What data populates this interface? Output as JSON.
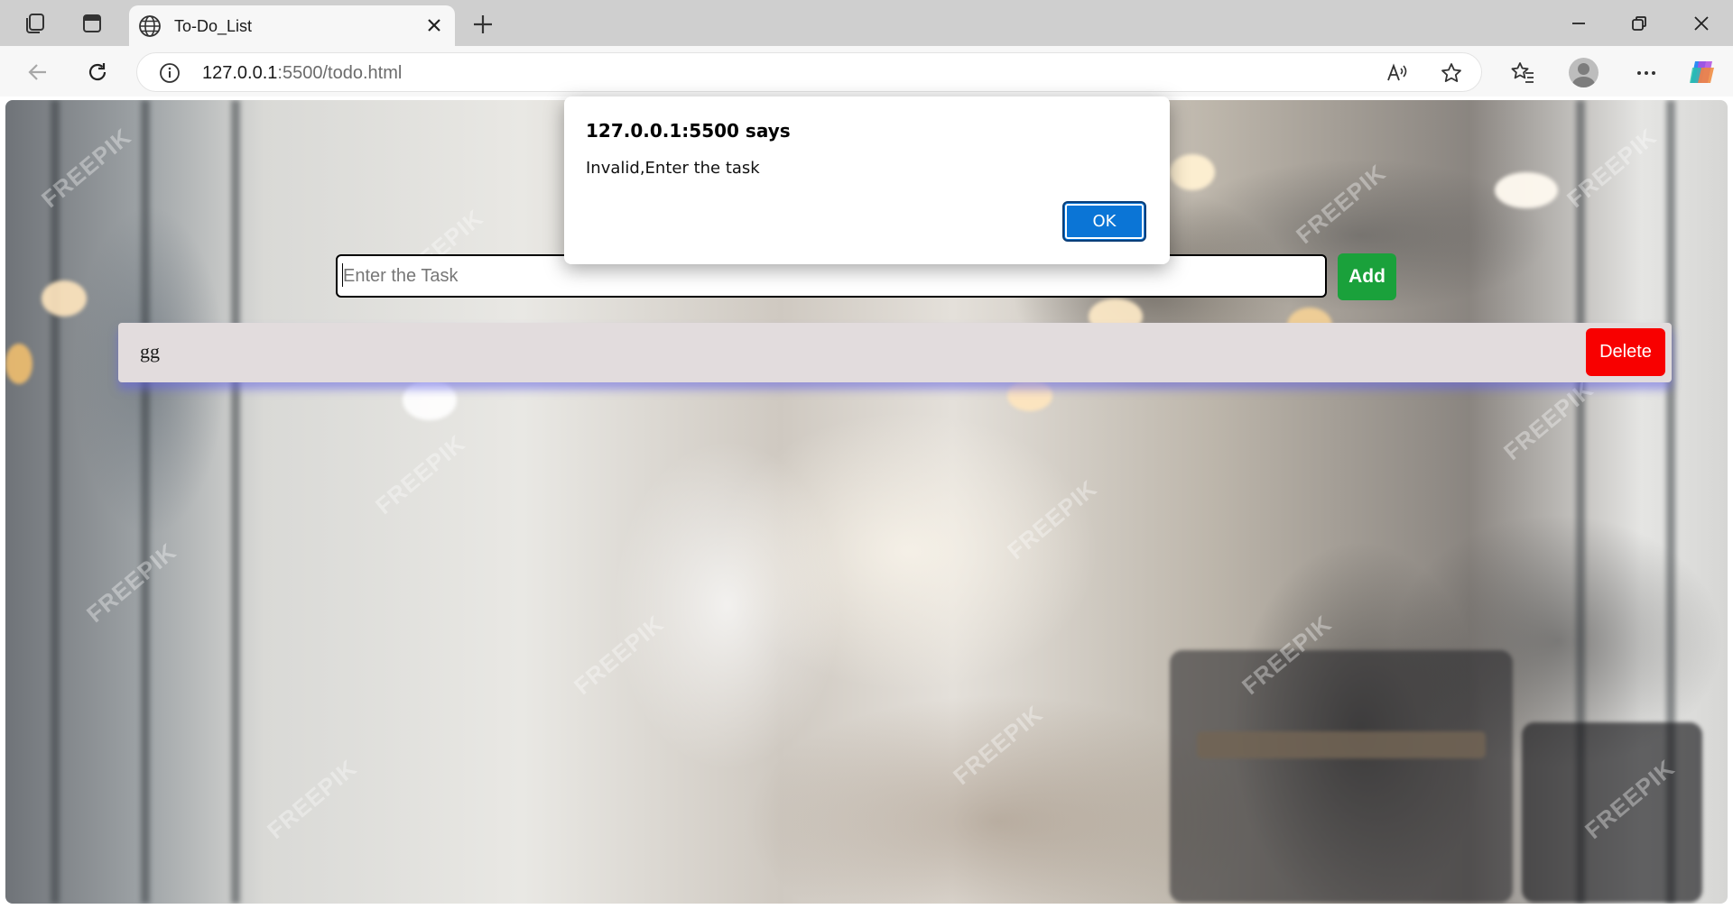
{
  "browser": {
    "tab_title": "To-Do_List",
    "url_host": "127.0.0.1",
    "url_rest": ":5500/todo.html"
  },
  "icons": {
    "workspaces": "workspaces-icon",
    "tab_actions": "tab-actions-icon",
    "site": "globe-icon",
    "tab_close": "close-icon",
    "new_tab": "plus-icon",
    "minimize": "minimize-icon",
    "restore": "restore-icon",
    "window_close": "close-icon",
    "back": "back-arrow-icon",
    "refresh": "refresh-icon",
    "info": "info-icon",
    "read_aloud": "read-aloud-icon",
    "favorite": "star-icon",
    "favorites": "favorites-icon",
    "profile": "profile-icon",
    "more": "more-icon",
    "copilot": "copilot-icon"
  },
  "todo": {
    "input_placeholder": "Enter the Task",
    "add_label": "Add",
    "items": [
      {
        "text": "gg",
        "delete_label": "Delete"
      }
    ],
    "colors": {
      "add": "#1aa13b",
      "delete": "#f80000",
      "item_bg": "#e2dcdd",
      "item_shadow": "#6464e6"
    }
  },
  "alert": {
    "title": "127.0.0.1:5500 says",
    "message": "Invalid,Enter the task",
    "ok_label": "OK",
    "ok_color": "#0b75d6"
  },
  "background": {
    "watermark_text": "FREEPIK"
  }
}
